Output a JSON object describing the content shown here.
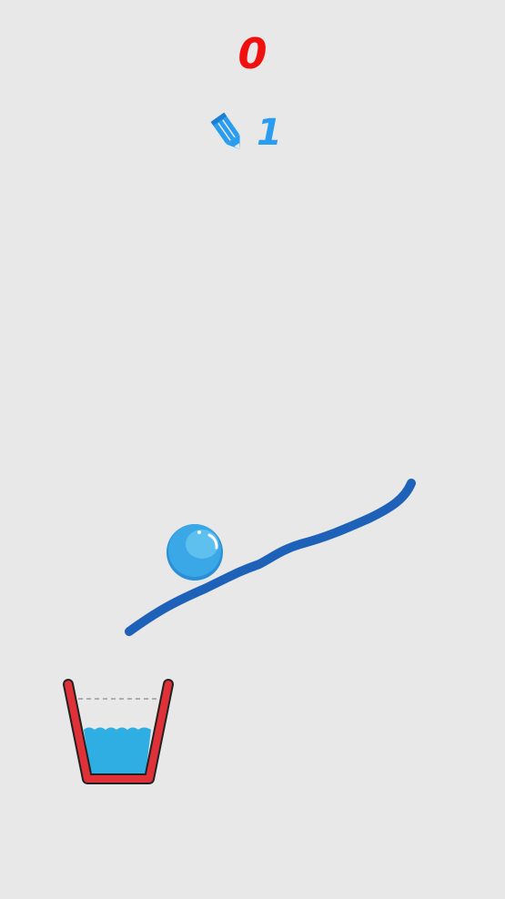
{
  "hud": {
    "score": "0",
    "pencil_count": "1",
    "pencil_icon": "pencil-icon"
  },
  "colors": {
    "background": "#e8e8e8",
    "score": "#f01010",
    "pencil": "#2a9df0",
    "drawn_line": "#1d62b8",
    "ball": "#3aa8e6",
    "cup": "#e03038",
    "water": "#2eaee3"
  },
  "game": {
    "cup_fill_level": 0.5
  }
}
